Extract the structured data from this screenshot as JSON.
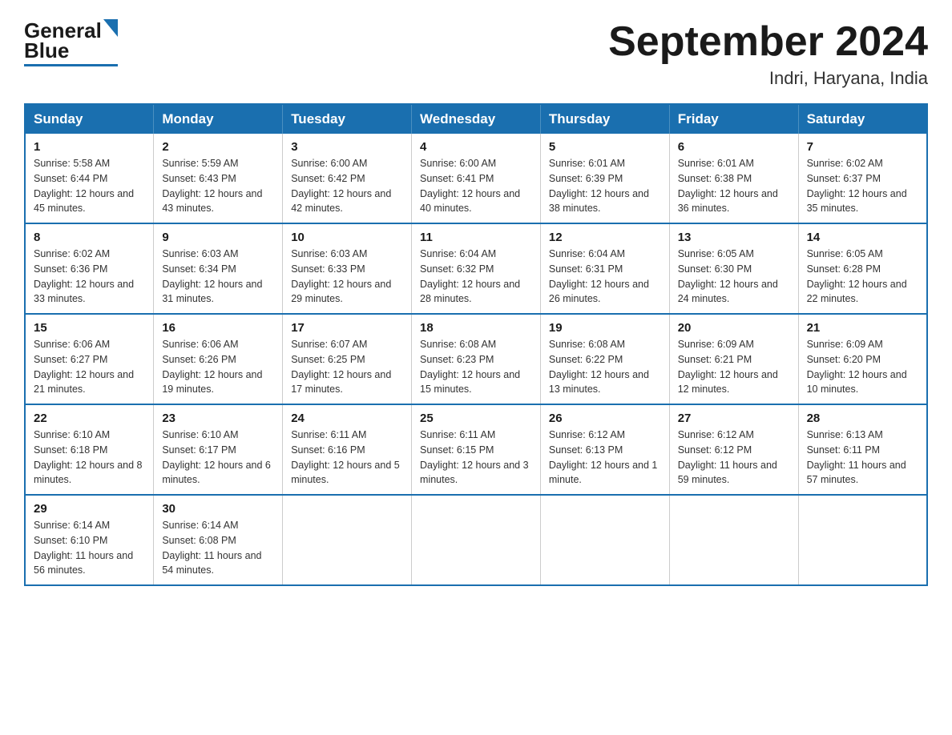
{
  "header": {
    "logo_general": "General",
    "logo_blue": "Blue",
    "month_year": "September 2024",
    "location": "Indri, Haryana, India"
  },
  "weekdays": [
    "Sunday",
    "Monday",
    "Tuesday",
    "Wednesday",
    "Thursday",
    "Friday",
    "Saturday"
  ],
  "weeks": [
    [
      {
        "day": "1",
        "sunrise": "5:58 AM",
        "sunset": "6:44 PM",
        "daylight": "12 hours and 45 minutes."
      },
      {
        "day": "2",
        "sunrise": "5:59 AM",
        "sunset": "6:43 PM",
        "daylight": "12 hours and 43 minutes."
      },
      {
        "day": "3",
        "sunrise": "6:00 AM",
        "sunset": "6:42 PM",
        "daylight": "12 hours and 42 minutes."
      },
      {
        "day": "4",
        "sunrise": "6:00 AM",
        "sunset": "6:41 PM",
        "daylight": "12 hours and 40 minutes."
      },
      {
        "day": "5",
        "sunrise": "6:01 AM",
        "sunset": "6:39 PM",
        "daylight": "12 hours and 38 minutes."
      },
      {
        "day": "6",
        "sunrise": "6:01 AM",
        "sunset": "6:38 PM",
        "daylight": "12 hours and 36 minutes."
      },
      {
        "day": "7",
        "sunrise": "6:02 AM",
        "sunset": "6:37 PM",
        "daylight": "12 hours and 35 minutes."
      }
    ],
    [
      {
        "day": "8",
        "sunrise": "6:02 AM",
        "sunset": "6:36 PM",
        "daylight": "12 hours and 33 minutes."
      },
      {
        "day": "9",
        "sunrise": "6:03 AM",
        "sunset": "6:34 PM",
        "daylight": "12 hours and 31 minutes."
      },
      {
        "day": "10",
        "sunrise": "6:03 AM",
        "sunset": "6:33 PM",
        "daylight": "12 hours and 29 minutes."
      },
      {
        "day": "11",
        "sunrise": "6:04 AM",
        "sunset": "6:32 PM",
        "daylight": "12 hours and 28 minutes."
      },
      {
        "day": "12",
        "sunrise": "6:04 AM",
        "sunset": "6:31 PM",
        "daylight": "12 hours and 26 minutes."
      },
      {
        "day": "13",
        "sunrise": "6:05 AM",
        "sunset": "6:30 PM",
        "daylight": "12 hours and 24 minutes."
      },
      {
        "day": "14",
        "sunrise": "6:05 AM",
        "sunset": "6:28 PM",
        "daylight": "12 hours and 22 minutes."
      }
    ],
    [
      {
        "day": "15",
        "sunrise": "6:06 AM",
        "sunset": "6:27 PM",
        "daylight": "12 hours and 21 minutes."
      },
      {
        "day": "16",
        "sunrise": "6:06 AM",
        "sunset": "6:26 PM",
        "daylight": "12 hours and 19 minutes."
      },
      {
        "day": "17",
        "sunrise": "6:07 AM",
        "sunset": "6:25 PM",
        "daylight": "12 hours and 17 minutes."
      },
      {
        "day": "18",
        "sunrise": "6:08 AM",
        "sunset": "6:23 PM",
        "daylight": "12 hours and 15 minutes."
      },
      {
        "day": "19",
        "sunrise": "6:08 AM",
        "sunset": "6:22 PM",
        "daylight": "12 hours and 13 minutes."
      },
      {
        "day": "20",
        "sunrise": "6:09 AM",
        "sunset": "6:21 PM",
        "daylight": "12 hours and 12 minutes."
      },
      {
        "day": "21",
        "sunrise": "6:09 AM",
        "sunset": "6:20 PM",
        "daylight": "12 hours and 10 minutes."
      }
    ],
    [
      {
        "day": "22",
        "sunrise": "6:10 AM",
        "sunset": "6:18 PM",
        "daylight": "12 hours and 8 minutes."
      },
      {
        "day": "23",
        "sunrise": "6:10 AM",
        "sunset": "6:17 PM",
        "daylight": "12 hours and 6 minutes."
      },
      {
        "day": "24",
        "sunrise": "6:11 AM",
        "sunset": "6:16 PM",
        "daylight": "12 hours and 5 minutes."
      },
      {
        "day": "25",
        "sunrise": "6:11 AM",
        "sunset": "6:15 PM",
        "daylight": "12 hours and 3 minutes."
      },
      {
        "day": "26",
        "sunrise": "6:12 AM",
        "sunset": "6:13 PM",
        "daylight": "12 hours and 1 minute."
      },
      {
        "day": "27",
        "sunrise": "6:12 AM",
        "sunset": "6:12 PM",
        "daylight": "11 hours and 59 minutes."
      },
      {
        "day": "28",
        "sunrise": "6:13 AM",
        "sunset": "6:11 PM",
        "daylight": "11 hours and 57 minutes."
      }
    ],
    [
      {
        "day": "29",
        "sunrise": "6:14 AM",
        "sunset": "6:10 PM",
        "daylight": "11 hours and 56 minutes."
      },
      {
        "day": "30",
        "sunrise": "6:14 AM",
        "sunset": "6:08 PM",
        "daylight": "11 hours and 54 minutes."
      },
      null,
      null,
      null,
      null,
      null
    ]
  ],
  "labels": {
    "sunrise": "Sunrise: ",
    "sunset": "Sunset: ",
    "daylight": "Daylight: "
  }
}
